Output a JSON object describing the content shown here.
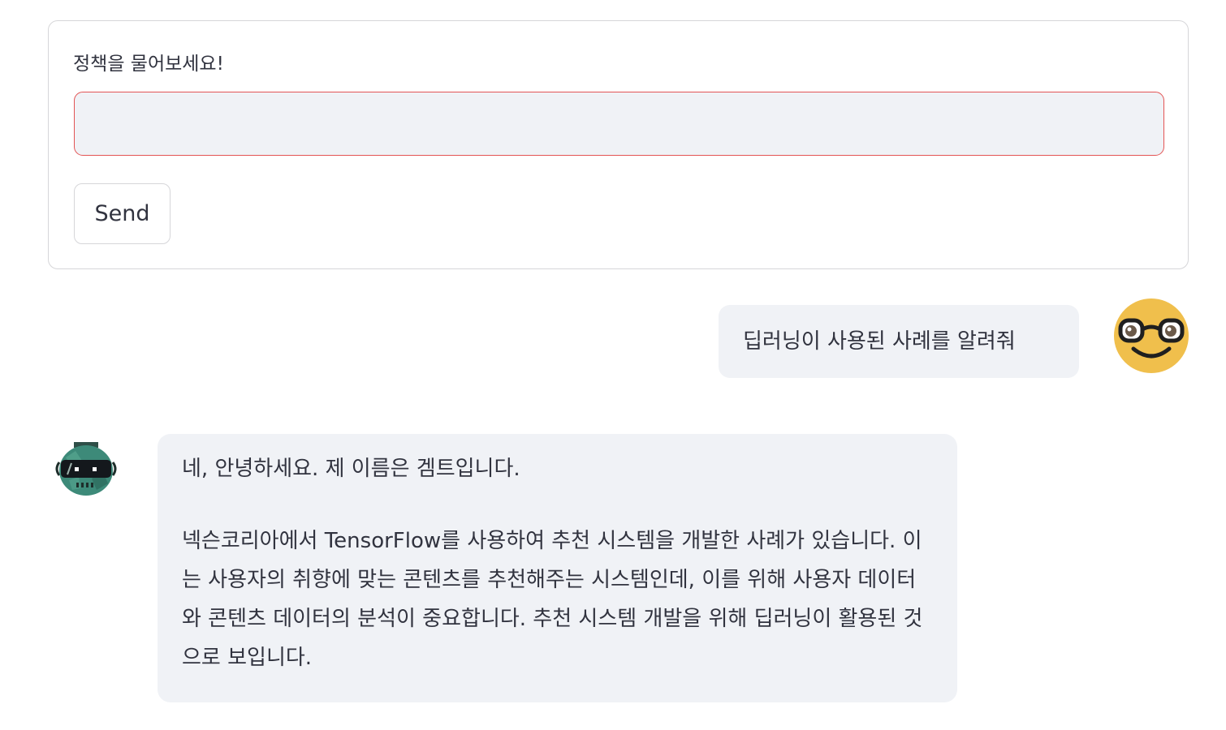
{
  "form": {
    "label": "정책을 물어보세요!",
    "input_value": "",
    "input_placeholder": "",
    "input_border_color": "#e35454",
    "send_label": "Send"
  },
  "messages": [
    {
      "role": "user",
      "avatar": "nerd-face-icon",
      "text": "딥러닝이 사용된 사례를 알려줘"
    },
    {
      "role": "assistant",
      "avatar": "robot-icon",
      "greeting": "네, 안녕하세요. 제 이름은 겜트입니다.",
      "body": "넥슨코리아에서 TensorFlow를 사용하여 추천 시스템을 개발한 사례가 있습니다. 이는 사용자의 취향에 맞는 콘텐츠를 추천해주는 시스템인데, 이를 위해 사용자 데이터와 콘텐츠 데이터의 분석이 중요합니다. 추천 시스템 개발을 위해 딥러닝이 활용된 것으로 보입니다."
    }
  ],
  "colors": {
    "bubble_bg": "#f0f2f6",
    "text": "#31333f",
    "border": "#d6d6d9",
    "user_avatar_bg": "#f0bf4c",
    "bot_avatar_bg": "#2e7d6b"
  }
}
